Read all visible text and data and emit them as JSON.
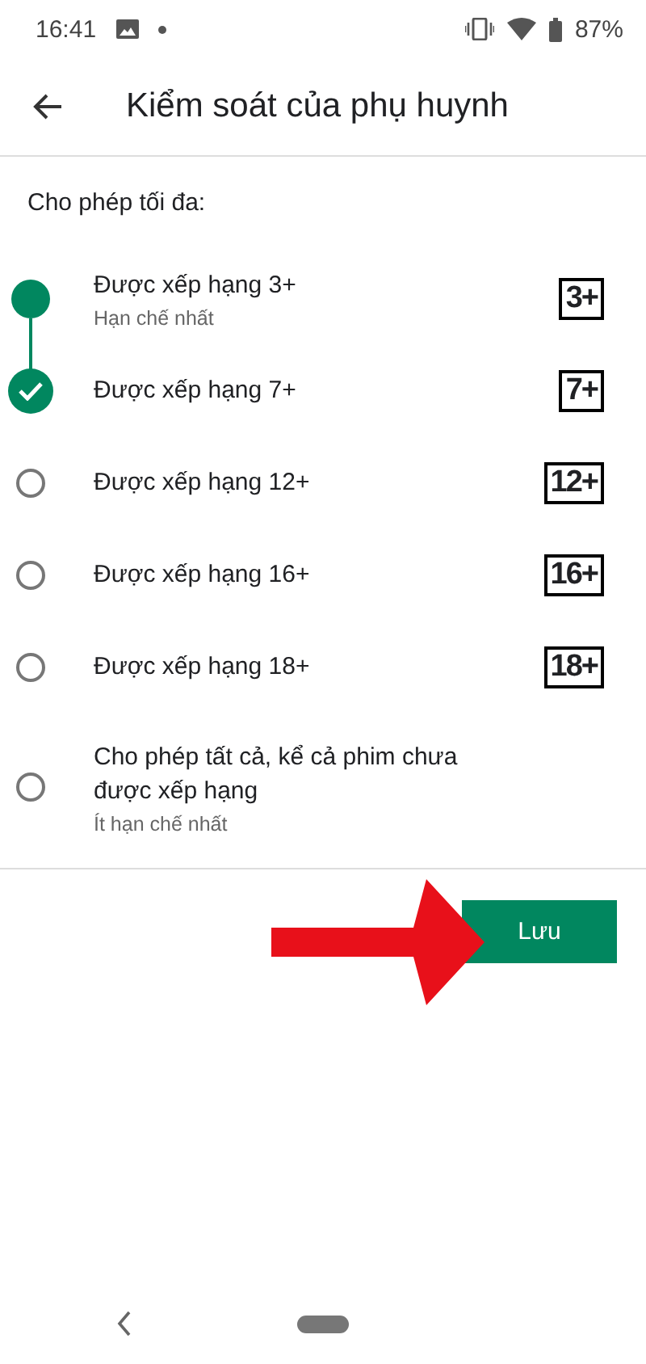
{
  "status_bar": {
    "time": "16:41",
    "battery": "87%"
  },
  "header": {
    "title": "Kiểm soát của phụ huynh"
  },
  "prompt": "Cho phép tối đa:",
  "options": [
    {
      "label": "Được xếp hạng 3+",
      "subtitle": "Hạn chế nhất",
      "badge": "3+",
      "included": true,
      "selected": false
    },
    {
      "label": "Được xếp hạng 7+",
      "badge": "7+",
      "included": false,
      "selected": true
    },
    {
      "label": "Được xếp hạng 12+",
      "badge": "12+",
      "included": false,
      "selected": false
    },
    {
      "label": "Được xếp hạng 16+",
      "badge": "16+",
      "included": false,
      "selected": false
    },
    {
      "label": "Được xếp hạng 18+",
      "badge": "18+",
      "included": false,
      "selected": false
    },
    {
      "label": "Cho phép tất cả, kể cả phim chưa được xếp hạng",
      "subtitle": "Ít hạn chế nhất",
      "included": false,
      "selected": false
    }
  ],
  "save_button": "Lưu"
}
